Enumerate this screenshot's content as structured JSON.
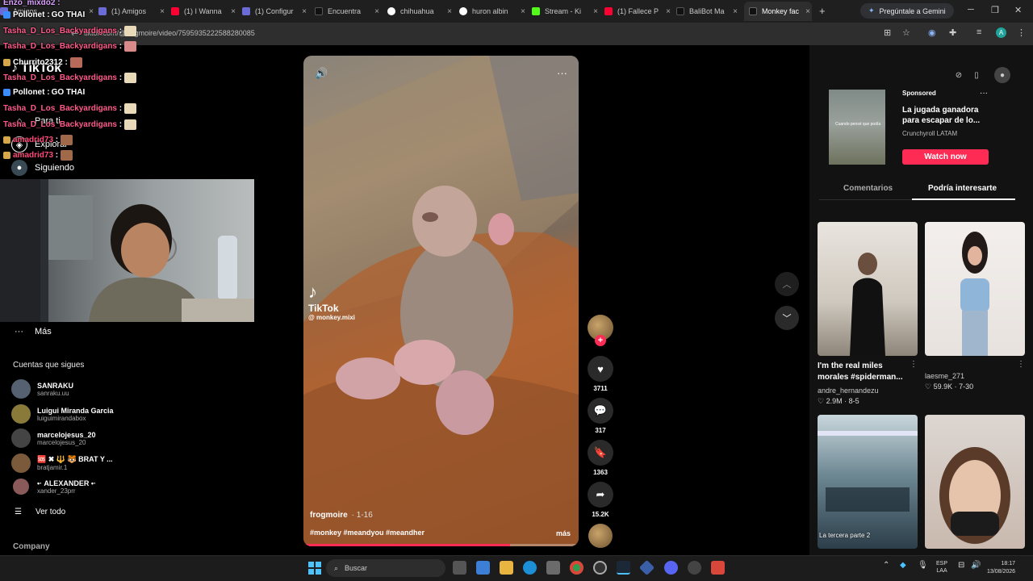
{
  "browser": {
    "tabs": [
      {
        "label": "Amigos",
        "favicon_color": "#6b6bd6"
      },
      {
        "label": "(1) Amigos",
        "favicon_color": "#6b6bd6"
      },
      {
        "label": "(1) I Wanna",
        "favicon_color": "#ff0033"
      },
      {
        "label": "(1) Configur",
        "favicon_color": "#6b6bd6"
      },
      {
        "label": "Encuentra",
        "favicon_color": "#111111"
      },
      {
        "label": "chihuahua",
        "favicon_color": "#ffffff"
      },
      {
        "label": "huron albin",
        "favicon_color": "#ffffff"
      },
      {
        "label": "Stream - Ki",
        "favicon_color": "#53fc18"
      },
      {
        "label": "(1) Fallece P",
        "favicon_color": "#ff0033"
      },
      {
        "label": "BaliBot Ma",
        "favicon_color": "#111111"
      },
      {
        "label": "Monkey fac",
        "favicon_color": "#111111"
      }
    ],
    "gemini_label": "Pregúntale a Gemini",
    "url": "tiktok.com/@frogmoire/video/7595935222588280085"
  },
  "chat": [
    {
      "user": "Pollonet",
      "color": "#ffffff",
      "msg": "GO THAI",
      "badge": "#3a8cff"
    },
    {
      "user": "Tasha_D_Los_Backyardigans",
      "color": "#ff5a8a",
      "msg": "",
      "badge": ""
    },
    {
      "user": "Tasha_D_Los_Backyardigans",
      "color": "#ff5a8a",
      "msg": "",
      "badge": ""
    },
    {
      "user": "Churrito2312",
      "color": "#ffffff",
      "msg": "",
      "badge": "#d6a64a"
    },
    {
      "user": "Tasha_D_Los_Backyardigans",
      "color": "#ff5a8a",
      "msg": "",
      "badge": ""
    },
    {
      "user": "Pollonet",
      "color": "#ffffff",
      "msg": "GO THAI",
      "badge": "#3a8cff"
    },
    {
      "user": "Tasha_D_Los_Backyardigans",
      "color": "#ff5a8a",
      "msg": "",
      "badge": ""
    },
    {
      "user": "Tasha_D_Los_Backyardigans",
      "color": "#ff5a8a",
      "msg": "",
      "badge": ""
    },
    {
      "user": "amadrid73",
      "color": "#ff4a7a",
      "msg": "",
      "badge": "#d6a64a"
    },
    {
      "user": "amadrid73",
      "color": "#ff4a7a",
      "msg": "",
      "badge": "#d6a64a"
    }
  ],
  "sidebar": {
    "logo": "TikTok",
    "nav": [
      {
        "label": "Para ti",
        "icon": "home-icon"
      },
      {
        "label": "Explorar",
        "icon": "compass-icon"
      },
      {
        "label": "Siguiendo",
        "icon": "following-icon"
      }
    ],
    "more_label": "Más",
    "following_title": "Cuentas que sigues",
    "accounts": [
      {
        "name": "SANRAKU",
        "handle": "sanraku.uu",
        "color": "#556070"
      },
      {
        "name": "Luigui Miranda Garcia",
        "handle": "luiguimirandabox",
        "color": "#8a7a3a"
      },
      {
        "name": "marcelojesus_20",
        "handle": "marcelojesus_20",
        "color": "#444444"
      },
      {
        "name": "🆘 ✖ 🔱 🐯 BRAT Y ...",
        "handle": "bratjamir.1",
        "color": "#7a5a3a"
      },
      {
        "name": "•· ALEXANDER •·",
        "handle": "xander_23prr",
        "color": "#8a5a5a"
      }
    ],
    "see_all": "Ver todo",
    "company": "Company"
  },
  "video": {
    "watermark_big": "TikTok",
    "watermark_handle": "@ monkey.mixi",
    "author": "frogmoire",
    "date": "1-16",
    "hashtags": "#monkey #meandyou #meandher",
    "more": "más",
    "progress": 0.75
  },
  "actions": {
    "likes": "3711",
    "comments": "317",
    "saves": "1363",
    "shares": "15.2K"
  },
  "right": {
    "sponsored": "Sponsored",
    "ad_title": "La jugada ganadora para escapar de lo...",
    "ad_source": "Crunchyroll LATAM",
    "ad_thumb_text": "Cuando pensé que podía",
    "watch_now": "Watch now",
    "tabs": [
      "Comentarios",
      "Podría interesarte"
    ],
    "cards": [
      {
        "title": "I'm the real miles morales #spiderman...",
        "author": "andre_hernandezu",
        "stats": "♡ 2.9M · 8-5",
        "caption": ""
      },
      {
        "title": "",
        "author": "laesme_271",
        "stats": "♡ 59.9K · 7-30",
        "caption": ""
      },
      {
        "title": "",
        "author": "",
        "stats": "",
        "caption": "La tercera parte 2"
      },
      {
        "title": "",
        "author": "",
        "stats": "",
        "caption": ""
      }
    ]
  },
  "taskbar": {
    "search_placeholder": "Buscar",
    "lang_top": "ESP",
    "lang_bottom": "LAA",
    "time": "18:17",
    "date": "13/08/2026"
  }
}
